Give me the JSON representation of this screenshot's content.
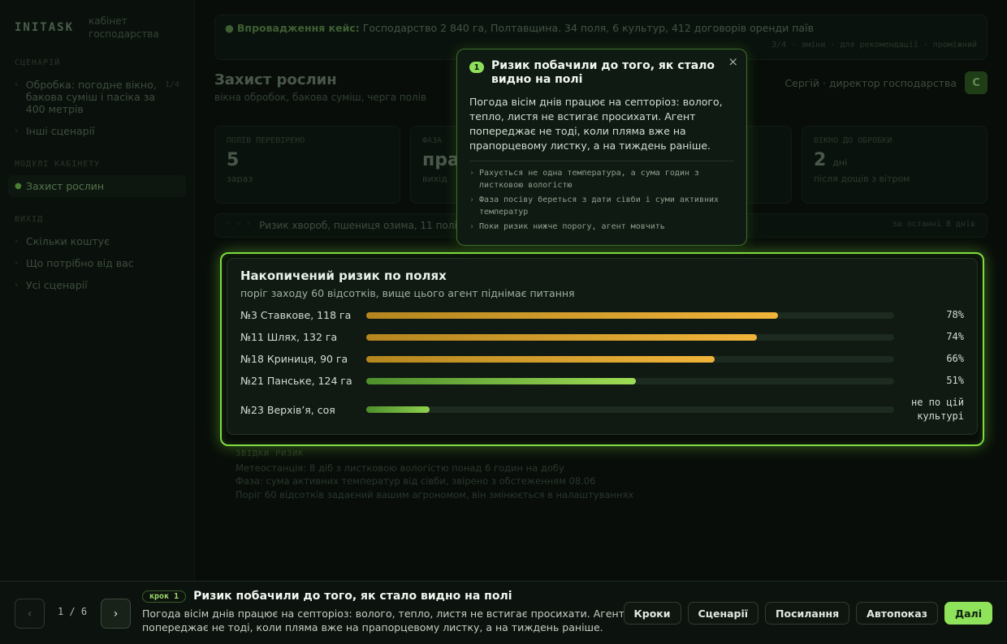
{
  "app": {
    "logo": "INITASK",
    "subtitle": "кабінет господарства"
  },
  "sidebar": {
    "group1": "СЦЕНАРІЙ",
    "item_scenario": "Обробка: погодне вікно, бакова суміш і пасіка за 400 метрів",
    "item_scenario_count": "1/4",
    "item_other": "Інші сценарії",
    "group2": "МОДУЛІ КАБІНЕТУ",
    "item_protect": "Захист рослин",
    "group3": "ВИХІД",
    "item_cost": "Скільки коштує",
    "item_need": "Що потрібно від вас",
    "item_all": "Усі сценарії"
  },
  "banner": {
    "label": "Впровадження кейс:",
    "text": "Господарство 2 840 га, Полтавщина. 34 поля, 6 культур, 412 договорів оренди паїв",
    "links": "3/4 · зміни · для рекомендації · проміжний"
  },
  "page": {
    "title": "Захист рослин",
    "subtitle": "вікна обробок, бакова суміш, черга полів",
    "user_name": "Сергій · директор господарства",
    "user_initial": "С"
  },
  "stats": [
    {
      "label": "ПОЛІВ ПЕРЕВІРЕНО",
      "value": "5",
      "unit": "",
      "note": "зараз"
    },
    {
      "label": "ФАЗА",
      "value": "пра",
      "unit": "",
      "note": "вихід"
    },
    {
      "label": "",
      "value": "",
      "unit": "",
      "note": ""
    },
    {
      "label": "ВІКНО ДО ОБРОБКИ",
      "value": "2",
      "unit": "дні",
      "note": "після дощів з вітром"
    }
  ],
  "filter": {
    "icons": "◦ ◦ ◦",
    "text": "Ризик хвороб, пшениця озима, 11 полів",
    "right": "за останні 8 днів"
  },
  "data_source": {
    "label": "ЗВІДКИ РИЗИК",
    "line1": "Метеостанція: 8 діб з листковою вологістю понад 6 годин на добу",
    "line2": "Фаза: сума активних температур від сівби, звірено з обстеженням 08.06",
    "line3": "Поріг 60 відсотків задаєний вашим агрономом, він змінюється в налаштуваннях"
  },
  "risk_card": {
    "title": "Накопичений ризик по полях",
    "subtitle": "поріг заходу 60 відсотків, вище цього агент піднімає питання",
    "rows": [
      {
        "name": "№3 Ставкове, 118 га",
        "value": 78,
        "label": "78%",
        "level": "high"
      },
      {
        "name": "№11 Шлях, 132 га",
        "value": 74,
        "label": "74%",
        "level": "high"
      },
      {
        "name": "№18 Криниця, 90 га",
        "value": 66,
        "label": "66%",
        "level": "high"
      },
      {
        "name": "№21 Панське, 124 га",
        "value": 51,
        "label": "51%",
        "level": "mid"
      },
      {
        "name": "№23 Верхів’я, соя",
        "value": 12,
        "label": "не по цій культурі",
        "level": "low"
      }
    ]
  },
  "tooltip": {
    "step_number": "1",
    "title": "Ризик побачили до того, як стало видно на полі",
    "close": "×",
    "body": "Погода вісім днів працює на септоріоз: волого, тепло, листя не встигає просихати. Агент попереджає не тоді, коли пляма вже на прапорцевому листку, а на тиждень раніше.",
    "bullets": [
      "Рахується не одна температура, а сума годин з листковою вологістю",
      "Фаза посіву береться з дати сівби і суми активних температур",
      "Поки ризик нижче порогу, агент мовчить"
    ]
  },
  "bottom": {
    "prev": "‹",
    "next": "›",
    "pager": "1 / 6",
    "step_badge": "крок 1",
    "step_title": "Ризик побачили до того, як стало видно на полі",
    "step_desc": "Погода вісім днів працює на септоріоз: волого, тепло, листя не встигає просихати. Агент попереджає не тоді, коли пляма вже на прапорцевому листку, а на тиждень раніше.",
    "actions": [
      "Кроки",
      "Сценарії",
      "Посилання",
      "Автопоказ",
      "Далі"
    ]
  },
  "colors": {
    "accent": "#8fe35a",
    "risk_high": "#f0b43a",
    "risk_mid": "#9fdc55"
  }
}
